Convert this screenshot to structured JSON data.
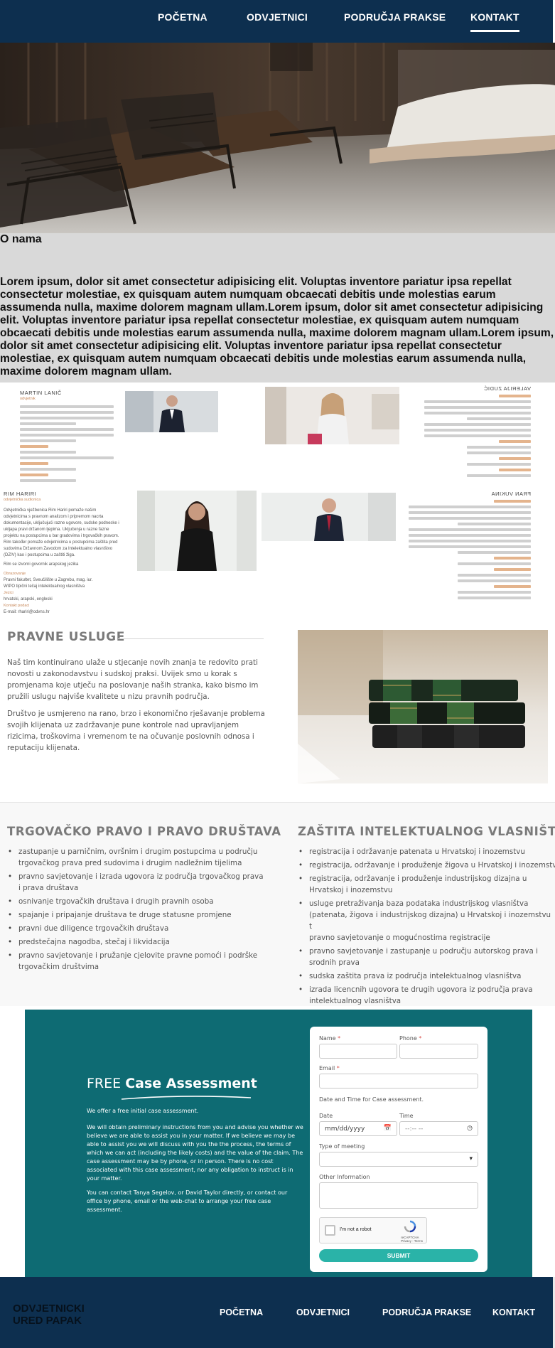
{
  "nav": {
    "items": [
      {
        "label": "POČETNA"
      },
      {
        "label": "ODVJETNICI"
      },
      {
        "label": "PODRUČJA PRAKSE"
      },
      {
        "label": "KONTAKT"
      }
    ],
    "active": "KONTAKT",
    "color": "#0d2f4f"
  },
  "about": {
    "title": "O nama",
    "text": "Lorem ipsum, dolor sit amet consectetur adipisicing elit. Voluptas inventore pariatur ipsa repellat consectetur molestiae, ex quisquam autem numquam obcaecati debitis unde molestias earum assumenda nulla, maxime dolorem magnam ullam.Lorem ipsum, dolor sit amet consectetur adipisicing elit. Voluptas inventore pariatur ipsa repellat consectetur molestiae, ex quisquam autem numquam obcaecati debitis unde molestias earum assumenda nulla, maxime dolorem magnam ullam.Lorem ipsum, dolor sit amet consectetur adipisicing elit. Voluptas inventore pariatur ipsa repellat consectetur molestiae, ex quisquam autem numquam obcaecati debitis unde molestias earum assumenda nulla, maxime dolorem magnam ullam.",
    "background": "#d9d9d9"
  },
  "team": {
    "top_left": {
      "name": "MARTIN LANIČ",
      "role": "odvjetnik"
    },
    "mid_left": {
      "name": "RIM HARIRI",
      "role": "odvjetnička sudionica",
      "bio": "Odvjetnička vježbenica Rim Hariri pomaže našim odvjetnicima s pravnom analizom i pripremom nacrta dokumentacije, uključujući razne ugovore, sudske podneske i ukljapa pravi držanom ljepima. Uključenja u razne fazne projektu na postupcima u bar gradovima i trgovačkih pravom. Rim također pomaže odvjetnicima u postupcima zaštita pred sudovima Državnom Zavodom za Intelektualno vlasništvo (DZIV) kao i postupcima u zaštiti žiga.",
      "languages": "Rim se izvorni govornik arapskog jezika",
      "education_label": "Obrazovanje",
      "education": "Pravni fakultet, Sveučilište u Zagrebu, mag. iur.",
      "education2": "WIPO tipični tečaj intelektualnog vlasništva",
      "langs_label": "Jezici",
      "langs": "hrvatski, arapski, engleski",
      "contact_label": "Kontakt podaci",
      "email": "E-mail: rhariri@odvns.hr"
    },
    "top_right": {
      "name": "VALERIJA ZUDIĆ"
    },
    "mid_right": {
      "name": "FRAN VUKINA"
    }
  },
  "services": {
    "title": "PRAVNE USLUGE",
    "p1": "Naš tim kontinuirano ulaže u stjecanje novih znanja te redovito prati novosti u zakonodavstvu i sudskoj praksi. Uvijek smo u korak s promjenama koje utječu na poslovanje naših stranka, kako bismo im pružili uslugu najviše kvalitete u nizu pravnih područja.",
    "p2": "Društvo je usmjereno na rano, brzo i ekonomično rješavanje problema svojih klijenata uz zadržavanje pune kontrole nad upravljanjem rizicima, troškovima i vremenom te na očuvanje poslovnih odnosa i reputaciju klijenata."
  },
  "areas": {
    "left": {
      "title": "TRGOVAČKO PRAVO I PRAVO DRUŠTAVA",
      "items": [
        "zastupanje u parničnim, ovršnim i drugim postupcima u području trgovačkog prava pred sudovima i drugim nadležnim tijelima",
        "pravno savjetovanje i izrada ugovora iz područja trgovačkog prava i prava društava",
        "osnivanje trgovačkih društava i drugih pravnih osoba",
        "spajanje i pripajanje društava te druge statusne promjene",
        "pravni due diligence trgovačkih društava",
        "predstečajna nagodba, stečaj i likvidacija",
        "pravno savjetovanje i pružanje cjelovite pravne pomoći i podrške trgovačkim društvima"
      ]
    },
    "right": {
      "title": "ZAŠTITA INTELEKTUALNOG VLASNIŠTVA",
      "items": [
        "registracija i održavanje patenata u Hrvatskoj i inozemstvu",
        "registracija, održavanje i produženje žigova u Hrvatskoj i inozemstv",
        "registracija, održavanje i produženje industrijskog dizajna u\nHrvatskoj i inozemstvu",
        "usluge pretraživanja baza podataka industrijskog vlasništva\n(patenata, žigova i industrijskog dizajna) u Hrvatskoj i inozemstvu t\npravno savjetovanje o mogućnostima registracije",
        "pravno savjetovanje i zastupanje u području autorskog prava i\nsrodnih prava",
        "sudska zaštita prava iz područja intelektualnog vlasništva",
        "izrada licencnih ugovora te drugih ugovora iz područja prava\nintelektualnog vlasništva"
      ]
    }
  },
  "case": {
    "heading_light": "FREE",
    "heading_bold": "Case Assessment",
    "p1": "We offer a free initial case assessment.",
    "p2": "We will obtain preliminary instructions from you and advise you whether we believe we are able to assist you in your matter. If we believe we may be able to assist you we will discuss with you the the process, the terms of which we can act (including the likely costs) and the value of the claim. The case assessment may be by phone, or in person. There is no cost associated with this case assessment, nor any obligation to instruct is in your matter.",
    "p3": "You can contact Tanya Segelov, or David Taylor directly, or contact our office by phone, email or the web-chat to arrange your free case assessment.",
    "color": "#0e6b73",
    "form": {
      "name_label": "Name",
      "phone_label": "Phone",
      "email_label": "Email",
      "required_mark": "*",
      "datetime_note": "Date and Time for Case assessment.",
      "date_label": "Date",
      "date_placeholder": "mm/dd/yyyy",
      "time_label": "Time",
      "time_placeholder": "--:-- --",
      "meeting_label": "Type of meeting",
      "other_label": "Other Information",
      "captcha_label": "I'm not a robot",
      "captcha_brand": "reCAPTCHA",
      "captcha_terms": "Privacy - Terms",
      "submit_label": "SUBMIT",
      "submit_color": "#2ab3a8"
    }
  },
  "footer": {
    "brand_line1": "ODVJETNICKI",
    "brand_line2": "URED PAPAK",
    "items": [
      {
        "label": "POČETNA"
      },
      {
        "label": "ODVJETNICI"
      },
      {
        "label": "PODRUČJA PRAKSE"
      },
      {
        "label": "KONTAKT"
      }
    ]
  }
}
